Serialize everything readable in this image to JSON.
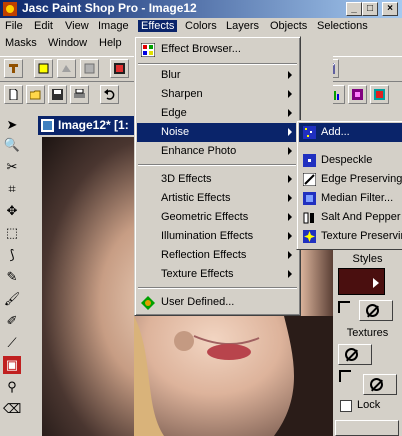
{
  "window": {
    "title": "Jasc Paint Shop Pro - Image12",
    "min": "_",
    "max": "□",
    "close": "×"
  },
  "menubar": {
    "items": [
      "File",
      "Edit",
      "View",
      "Image",
      "Effects",
      "Colors",
      "Layers",
      "Objects",
      "Selections"
    ],
    "items2": [
      "Masks",
      "Window",
      "Help"
    ]
  },
  "image_window": {
    "title": "Image12* [1:"
  },
  "effects_menu": {
    "effect_browser": "Effect Browser...",
    "items": [
      "Blur",
      "Sharpen",
      "Edge",
      "Noise",
      "Enhance Photo",
      "3D Effects",
      "Artistic Effects",
      "Geometric Effects",
      "Illumination Effects",
      "Reflection Effects",
      "Texture Effects"
    ],
    "user_defined": "User Defined..."
  },
  "noise_submenu": {
    "items": [
      "Add...",
      "Despeckle",
      "Edge Preserving",
      "Median Filter...",
      "Salt And Pepper",
      "Texture Preserving"
    ]
  },
  "palette": {
    "styles_label": "Styles",
    "textures_label": "Textures",
    "lock_label": "Lock",
    "lock_checked": false,
    "style_color": "#4a0f0f"
  },
  "colors": {
    "title_bar": "#0a246a",
    "highlight": "#0a246a",
    "face": "#d4d0c8"
  }
}
